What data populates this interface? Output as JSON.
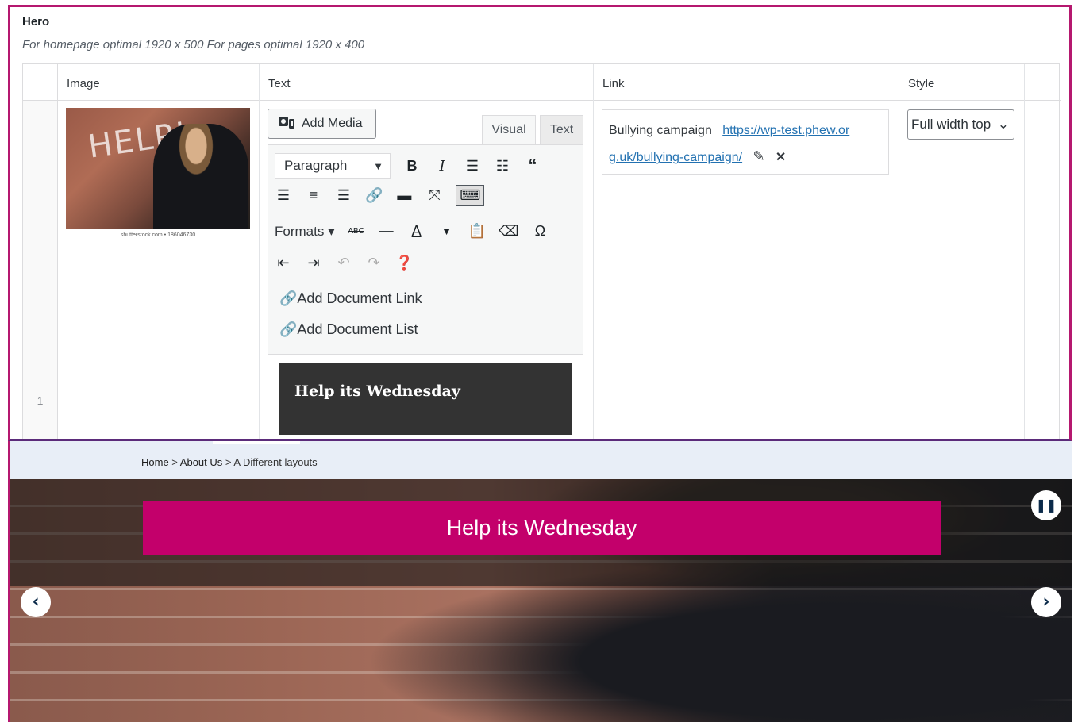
{
  "admin": {
    "title": "Hero",
    "description": "For homepage optimal 1920 x 500 For pages optimal 1920 x 400",
    "columns": {
      "image": "Image",
      "text": "Text",
      "link": "Link",
      "style": "Style"
    },
    "row_number": "1",
    "image_credit": "shutterstock.com • 186046730",
    "image_text": "HELP!",
    "editor": {
      "add_media": "Add Media",
      "tab_visual": "Visual",
      "tab_text": "Text",
      "paragraph": "Paragraph",
      "formats": "Formats",
      "add_document_link": "Add Document Link",
      "add_document_list": "Add Document List",
      "content": "Help its Wednesday"
    },
    "link": {
      "title": "Bullying campaign",
      "url_part1": "https://wp-test.phew.or",
      "url_part2": "g.uk/bullying-campaign/"
    },
    "style_value": "Full width top"
  },
  "site": {
    "breadcrumb": {
      "home": "Home",
      "about": "About Us",
      "current": "> A Different layouts",
      "sep": " > "
    },
    "hero_title": "Help its Wednesday"
  },
  "colors": {
    "accent": "#c3006b",
    "border": "#b5186f",
    "link": "#2271b1"
  }
}
